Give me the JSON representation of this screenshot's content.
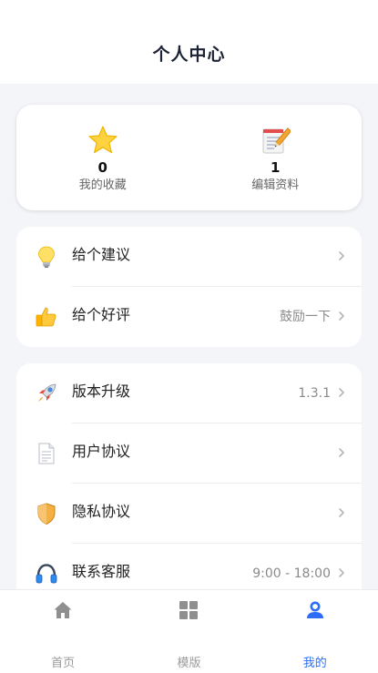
{
  "header": {
    "title": "个人中心"
  },
  "stats": [
    {
      "icon": "star-icon",
      "count": "0",
      "label": "我的收藏"
    },
    {
      "icon": "memo-icon",
      "count": "1",
      "label": "编辑资料"
    }
  ],
  "group1": [
    {
      "icon": "lightbulb-icon",
      "label": "给个建议",
      "value": ""
    },
    {
      "icon": "thumbs-up-icon",
      "label": "给个好评",
      "value": "鼓励一下"
    }
  ],
  "group2": [
    {
      "icon": "rocket-icon",
      "label": "版本升级",
      "value": "1.3.1"
    },
    {
      "icon": "document-icon",
      "label": "用户协议",
      "value": ""
    },
    {
      "icon": "shield-icon",
      "label": "隐私协议",
      "value": ""
    },
    {
      "icon": "headphones-icon",
      "label": "联系客服",
      "value": "9:00 - 18:00"
    }
  ],
  "tabbar": {
    "items": [
      {
        "icon": "home-icon",
        "label": "首页",
        "active": false
      },
      {
        "icon": "grid-icon",
        "label": "模版",
        "active": false
      },
      {
        "icon": "user-icon",
        "label": "我的",
        "active": true
      }
    ],
    "active_color": "#2d6df6",
    "inactive_color": "#9a9a9a"
  }
}
